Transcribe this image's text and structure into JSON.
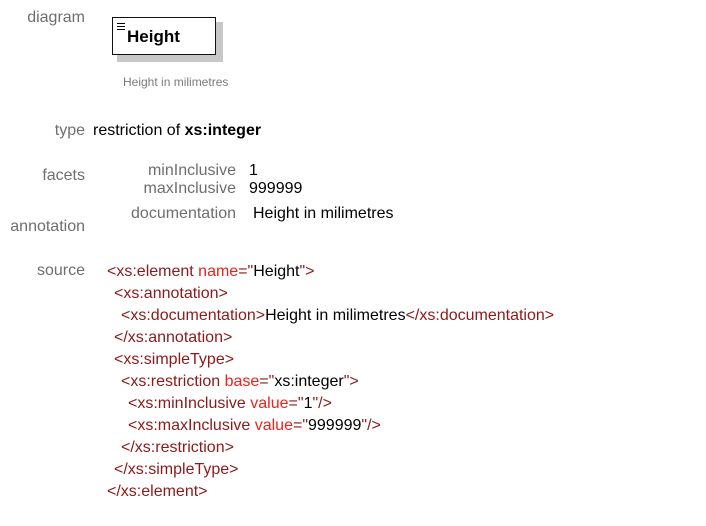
{
  "labels": {
    "diagram": "diagram",
    "type": "type",
    "facets": "facets",
    "annotation": "annotation",
    "source": "source"
  },
  "diagram": {
    "element_name": "Height",
    "documentation": "Height in milimetres"
  },
  "type": {
    "prefix": "restriction of",
    "base": "xs:integer"
  },
  "facets": [
    {
      "name": "minInclusive",
      "value": "1"
    },
    {
      "name": "maxInclusive",
      "value": "999999"
    }
  ],
  "annotation": {
    "key": "documentation",
    "value": "Height in milimetres"
  },
  "source": {
    "l1_open": "<xs:element",
    "l1_attr": "name",
    "l1_eq": "=\"",
    "l1_val": "Height",
    "l1_close": "\">",
    "l2": "<xs:annotation>",
    "l3_open": "<xs:documentation>",
    "l3_text": "Height in milimetres",
    "l3_close": "</xs:documentation>",
    "l4": "</xs:annotation>",
    "l5": "<xs:simpleType>",
    "l6_open": "<xs:restriction",
    "l6_attr": "base",
    "l6_eq": "=\"",
    "l6_val": "xs:integer",
    "l6_close": "\">",
    "l7_open": "<xs:minInclusive",
    "l7_attr": "value",
    "l7_eq": "=\"",
    "l7_val": "1",
    "l7_close": "\"/>",
    "l8_open": "<xs:maxInclusive",
    "l8_attr": "value",
    "l8_eq": "=\"",
    "l8_val": "999999",
    "l8_close": "\"/>",
    "l9": "</xs:restriction>",
    "l10": "</xs:simpleType>",
    "l11": "</xs:element>"
  },
  "colors": {
    "tag": "#8b1a1a",
    "attribute": "#e8231c",
    "label": "#6e6e6e"
  }
}
